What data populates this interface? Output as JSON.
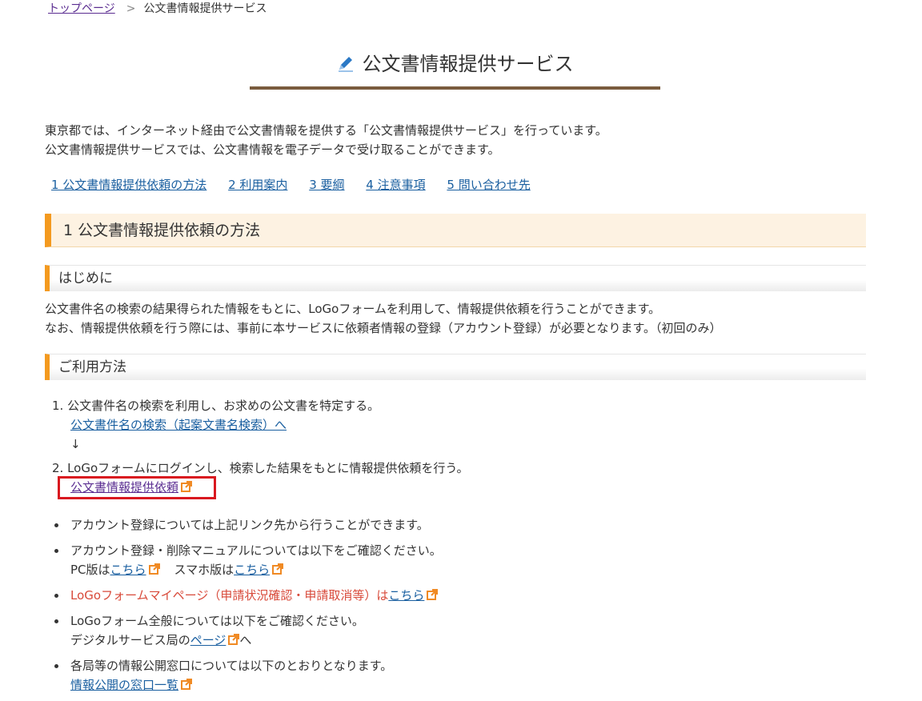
{
  "breadcrumb": {
    "home": "トップページ",
    "separator": ">",
    "current": "公文書情報提供サービス"
  },
  "page_title": "公文書情報提供サービス",
  "intro": [
    "東京都では、インターネット経由で公文書情報を提供する「公文書情報提供サービス」を行っています。",
    "公文書情報提供サービスでは、公文書情報を電子データで受け取ることができます。"
  ],
  "toc": [
    "1 公文書情報提供依頼の方法",
    "2 利用案内",
    "3 要綱",
    "4 注意事項",
    "5 問い合わせ先"
  ],
  "section1": {
    "heading": "1 公文書情報提供依頼の方法",
    "intro_heading": "はじめに",
    "intro_lines": [
      "公文書件名の検索の結果得られた情報をもとに、LoGoフォームを利用して、情報提供依頼を行うことができます。",
      "なお、情報提供依頼を行う際には、事前に本サービスに依頼者情報の登録（アカウント登録）が必要となります。（初回のみ）"
    ],
    "usage_heading": "ご利用方法",
    "steps": [
      {
        "num": "1.",
        "text": "公文書件名の検索を利用し、お求めの公文書を特定する。",
        "link": "公文書件名の検索（起案文書名検索）へ"
      },
      {
        "num": "2.",
        "text": "LoGoフォームにログインし、検索した結果をもとに情報提供依頼を行う。",
        "link": "公文書情報提供依頼"
      }
    ],
    "arrow": "↓",
    "bullets": {
      "account": "アカウント登録については上記リンク先から行うことができます。",
      "manual_text": "アカウント登録・削除マニュアルについては以下をご確認ください。",
      "pc_prefix": "PC版は",
      "pc_link": "こちら",
      "sp_prefix": "スマホ版は",
      "sp_link": "こちら",
      "mypage_text": "LoGoフォームマイページ（申請状況確認・申請取消等）は",
      "mypage_link": "こちら",
      "general_text": "LoGoフォーム全般については以下をご確認ください。",
      "digital_prefix": "デジタルサービス局の",
      "digital_link": "ページ",
      "digital_suffix": "へ",
      "window_text": "各局等の情報公開窓口については以下のとおりとなります。",
      "window_link": "情報公開の窓口一覧"
    }
  },
  "colors": {
    "accent": "#f49a1f",
    "link": "#1a5fa0",
    "visited": "#5b2d91",
    "alert": "#d84a3a",
    "highlight": "#d9181f"
  }
}
